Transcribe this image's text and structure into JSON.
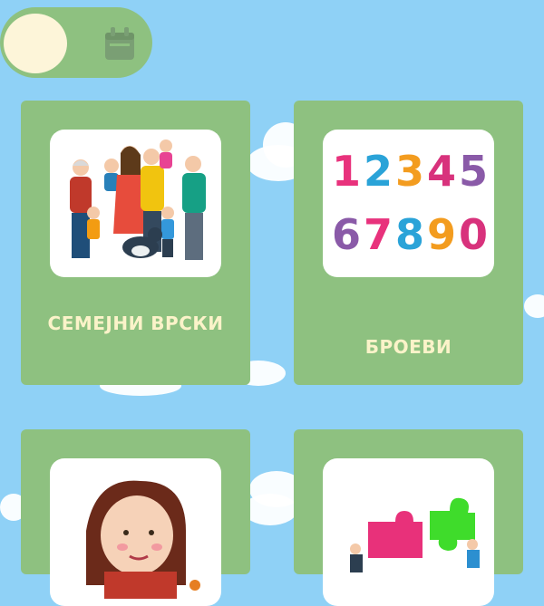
{
  "toggle": {
    "icon": "calendar-icon"
  },
  "cards": [
    {
      "label": "СЕМЕЈНИ ВРСКИ",
      "image": "family-illustration"
    },
    {
      "label": "БРОЕВИ",
      "image": "numbers-illustration",
      "numbers_row1": [
        "1",
        "2",
        "3",
        "4",
        "5"
      ],
      "numbers_row2": [
        "6",
        "7",
        "8",
        "9",
        "0"
      ]
    },
    {
      "label": "",
      "image": "girl-reading-illustration"
    },
    {
      "label": "",
      "image": "puzzle-illustration"
    }
  ],
  "colors": {
    "background": "#8fd1f6",
    "card": "#8ec180",
    "label": "#fbf3c9",
    "numbers_row1": [
      "#e8327c",
      "#2aa3d8",
      "#f39c1f",
      "#d8327c",
      "#8a5aa8"
    ],
    "numbers_row2": [
      "#8a5aa8",
      "#e8327c",
      "#2aa3d8",
      "#f39c1f",
      "#d8327c"
    ]
  }
}
